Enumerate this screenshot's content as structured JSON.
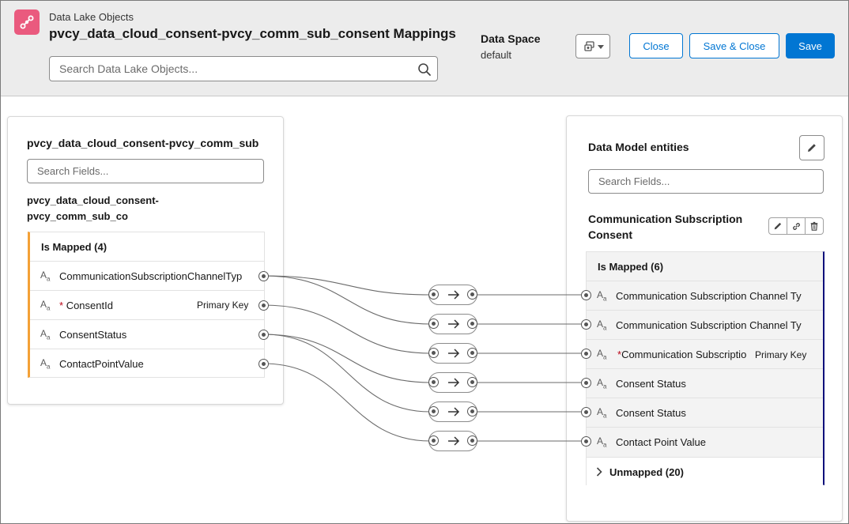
{
  "header": {
    "eyebrow": "Data Lake Objects",
    "title": "pvcy_data_cloud_consent-pvcy_comm_sub_consent Mappings",
    "search_placeholder": "Search Data Lake Objects...",
    "data_space_label": "Data Space",
    "data_space_value": "default",
    "buttons": {
      "close": "Close",
      "save_close": "Save & Close",
      "save": "Save"
    }
  },
  "source": {
    "title": "pvcy_data_cloud_consent-pvcy_comm_sub",
    "search_placeholder": "Search Fields...",
    "object_name_line1": "pvcy_data_cloud_consent-",
    "object_name_line2": "pvcy_comm_sub_co",
    "group_label": "Is Mapped (4)",
    "fields": [
      {
        "name": "CommunicationSubscriptionChannelTyp",
        "required": false,
        "key": ""
      },
      {
        "name": "ConsentId",
        "required": true,
        "key": "Primary Key"
      },
      {
        "name": "ConsentStatus",
        "required": false,
        "key": ""
      },
      {
        "name": "ContactPointValue",
        "required": false,
        "key": ""
      }
    ]
  },
  "target": {
    "title": "Data Model entities",
    "search_placeholder": "Search Fields...",
    "entity_name_line1": "Communication Subscription",
    "entity_name_line2": "Consent",
    "group_label": "Is Mapped (6)",
    "fields": [
      {
        "name": "Communication Subscription Channel Ty",
        "required": false,
        "key": ""
      },
      {
        "name": "Communication Subscription Channel Ty",
        "required": false,
        "key": ""
      },
      {
        "name": "Communication Subscriptio",
        "required": true,
        "key": "Primary Key"
      },
      {
        "name": "Consent Status",
        "required": false,
        "key": ""
      },
      {
        "name": "Consent Status",
        "required": false,
        "key": ""
      },
      {
        "name": "Contact Point Value",
        "required": false,
        "key": ""
      }
    ],
    "unmapped_label": "Unmapped (20)"
  },
  "field_type_icon": "text-type-icon",
  "colors": {
    "brand": "#0176d3",
    "mapped_source_bar": "#f4a137",
    "mapped_target_bar": "#0b0f7b",
    "app_icon": "#ea5a7e",
    "required": "#ba0517"
  }
}
